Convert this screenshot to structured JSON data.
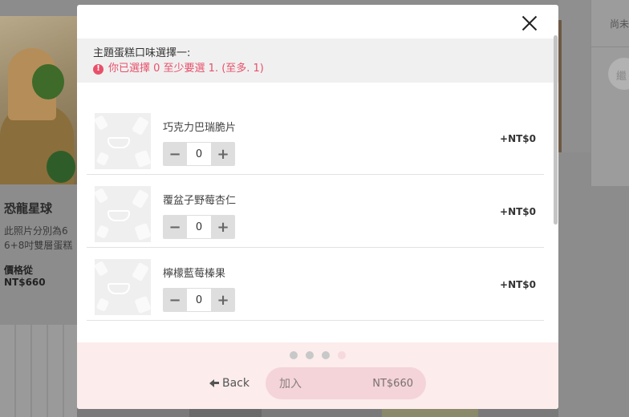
{
  "background": {
    "product_title": "恐龍星球",
    "product_desc_line1": "此照片分別為6",
    "product_desc_line2": "6+8吋雙層蛋糕",
    "price_label": "價格從",
    "price_value": "NT$660",
    "right_panel_text": "尚未",
    "right_panel_button": "繼"
  },
  "modal": {
    "section_title": "主題蛋糕口味選擇一:",
    "section_warning": "你已選擇 0 至少要選 1. (至多. 1)",
    "warning_icon": "!",
    "items": [
      {
        "name": "巧克力巴瑞脆片",
        "quantity": "0",
        "price": "+NT$0"
      },
      {
        "name": "覆盆子野莓杏仁",
        "quantity": "0",
        "price": "+NT$0"
      },
      {
        "name": "檸檬藍莓榛果",
        "quantity": "0",
        "price": "+NT$0"
      }
    ],
    "stepper": {
      "minus": "−",
      "plus": "+"
    },
    "footer": {
      "back_label": "Back",
      "add_label": "加入",
      "add_price": "NT$660"
    }
  }
}
